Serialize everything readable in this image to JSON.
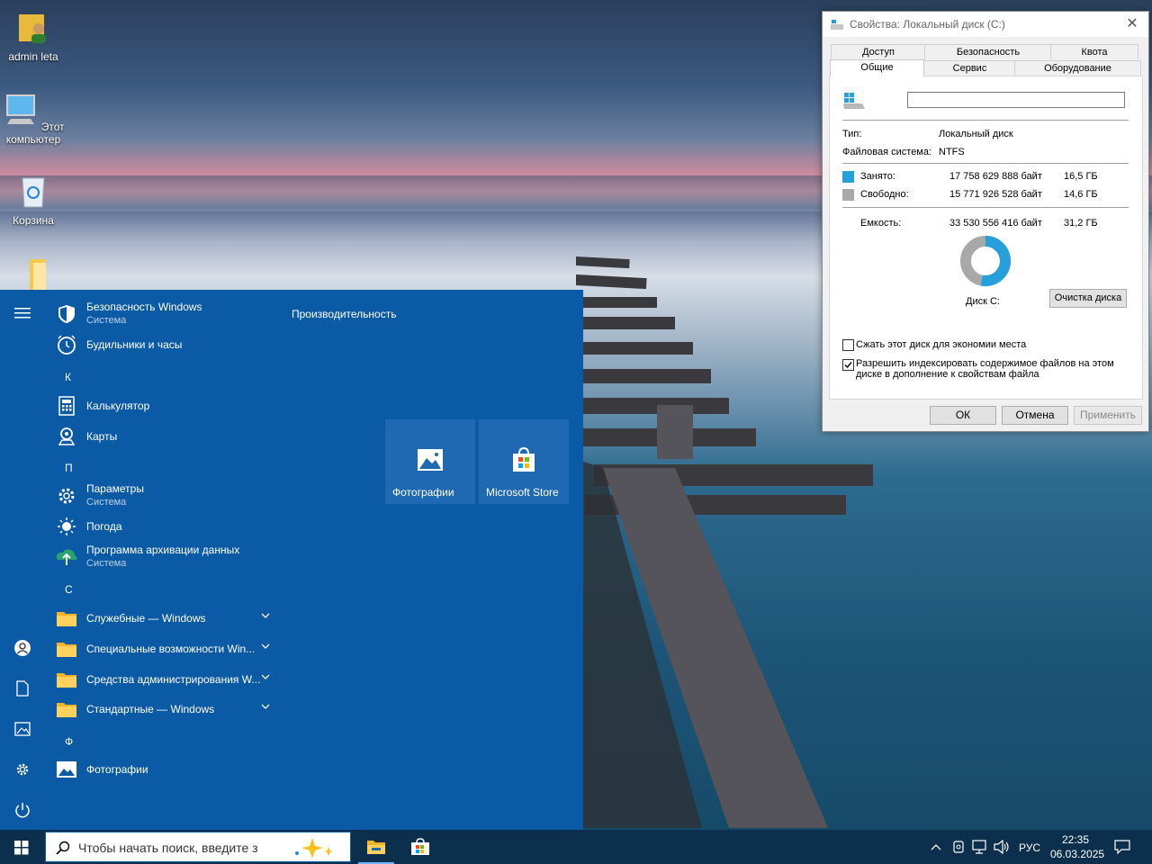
{
  "desktop": {
    "icons": [
      {
        "label": "admin leta"
      },
      {
        "label": "Этот компьютер"
      },
      {
        "label": "Корзина"
      },
      {
        "label": ""
      }
    ]
  },
  "start_menu": {
    "apps": [
      {
        "name": "Безопасность Windows",
        "sub": "Система"
      },
      {
        "name": "Будильники и часы",
        "sub": ""
      },
      {
        "name": "Калькулятор",
        "sub": ""
      },
      {
        "name": "Карты",
        "sub": ""
      },
      {
        "name": "Параметры",
        "sub": "Система"
      },
      {
        "name": "Погода",
        "sub": ""
      },
      {
        "name": "Программа архивации данных",
        "sub": "Система"
      },
      {
        "name": "Служебные — Windows",
        "sub": ""
      },
      {
        "name": "Специальные возможности Win...",
        "sub": ""
      },
      {
        "name": "Средства администрирования W...",
        "sub": ""
      },
      {
        "name": "Стандартные — Windows",
        "sub": ""
      },
      {
        "name": "Фотографии",
        "sub": ""
      }
    ],
    "letters": [
      "К",
      "П",
      "С",
      "Ф"
    ],
    "group_title": "Производительность",
    "tiles": [
      {
        "label": "Фотографии"
      },
      {
        "label": "Microsoft Store"
      }
    ]
  },
  "dialog": {
    "title": "Свойства: Локальный диск (C:)",
    "tabs_row1": [
      "Доступ",
      "Безопасность",
      "Квота"
    ],
    "tabs_row2": [
      "Общие",
      "Сервис",
      "Оборудование"
    ],
    "active_tab": "Общие",
    "name_value": "",
    "type_label": "Тип:",
    "type_value": "Локальный диск",
    "fs_label": "Файловая система:",
    "fs_value": "NTFS",
    "used": {
      "label": "Занято:",
      "bytes": "17 758 629 888 байт",
      "size": "16,5 ГБ",
      "color": "#26a0da"
    },
    "free": {
      "label": "Свободно:",
      "bytes": "15 771 926 528 байт",
      "size": "14,6 ГБ",
      "color": "#a8a8a8"
    },
    "capacity": {
      "label": "Емкость:",
      "bytes": "33 530 556 416 байт",
      "size": "31,2 ГБ"
    },
    "used_fraction": 0.53,
    "disk_label": "Диск C:",
    "cleanup_button": "Очистка диска",
    "compress_label": "Сжать этот диск для экономии места",
    "compress_checked": false,
    "index_label_1": "Разрешить индексировать содержимое файлов на этом",
    "index_label_2": "диске в дополнение к свойствам файла",
    "index_checked": true,
    "ok": "ОК",
    "cancel": "Отмена",
    "apply": "Применить"
  },
  "taskbar": {
    "search_placeholder": "Чтобы начать поиск, введите з",
    "language": "РУС",
    "time": "22:35",
    "date": "06.03.2025"
  }
}
